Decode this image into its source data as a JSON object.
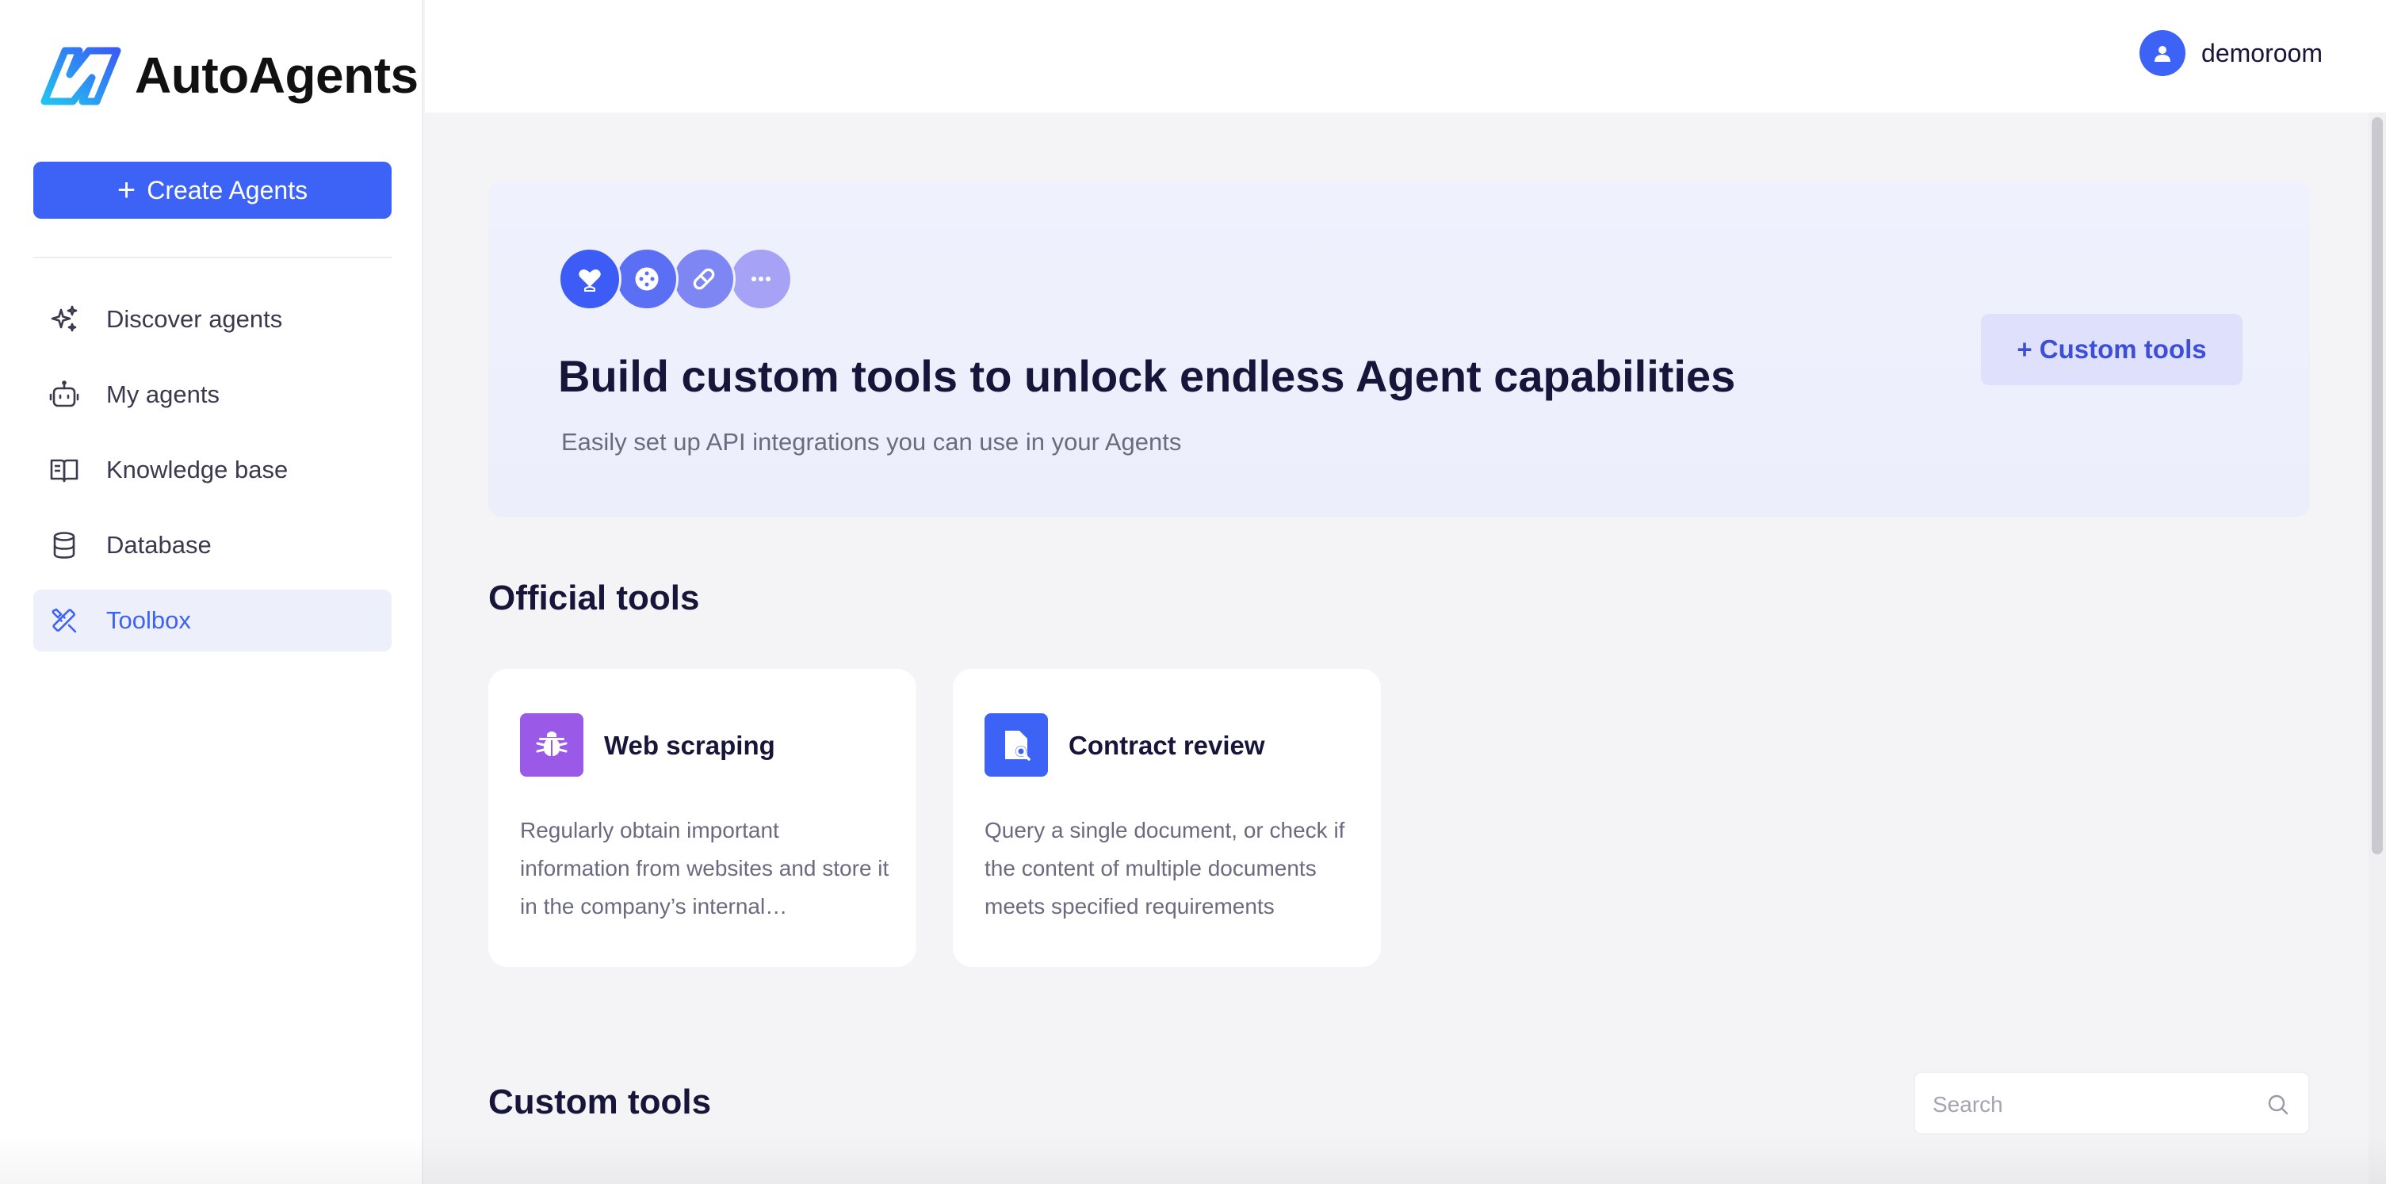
{
  "app": {
    "name": "AutoAgents"
  },
  "sidebar": {
    "create_label": "Create Agents",
    "items": [
      {
        "label": "Discover agents",
        "icon": "sparkles-icon"
      },
      {
        "label": "My agents",
        "icon": "robot-icon"
      },
      {
        "label": "Knowledge base",
        "icon": "book-icon"
      },
      {
        "label": "Database",
        "icon": "database-icon"
      },
      {
        "label": "Toolbox",
        "icon": "tools-icon",
        "active": true
      }
    ]
  },
  "header": {
    "username": "demoroom"
  },
  "banner": {
    "title": "Build custom tools to unlock endless Agent capabilities",
    "subtitle": "Easily set up API integrations you can use in your Agents",
    "button_label": "+ Custom tools",
    "icons": [
      "heart-hand-icon",
      "gamepad-icon",
      "pill-icon",
      "more-icon"
    ]
  },
  "official": {
    "title": "Official tools",
    "cards": [
      {
        "title": "Web scraping",
        "desc": "Regularly obtain important information from websites and store it in the company’s internal…",
        "icon": "spider-icon",
        "color": "#9b59e8"
      },
      {
        "title": "Contract review",
        "desc": "Query a single document, or check if the content of multiple documents meets specified requirements",
        "icon": "document-search-icon",
        "color": "#3d63f6"
      }
    ]
  },
  "custom": {
    "title": "Custom tools",
    "search_placeholder": "Search"
  },
  "colors": {
    "accent": "#3d63f6",
    "text": "#17153a",
    "muted": "#6b6b80"
  }
}
